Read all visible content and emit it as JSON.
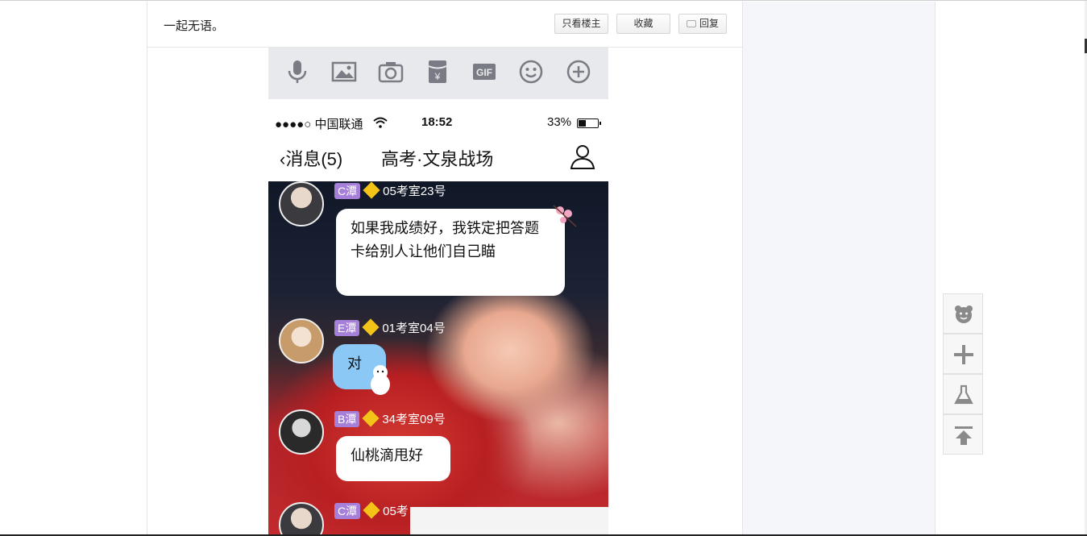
{
  "post": {
    "text": "一起无语。",
    "buttons": {
      "only_op": "只看楼主",
      "favorite": "收藏",
      "reply": "回复"
    }
  },
  "embedded_screenshot": {
    "toolbar_icons": [
      "microphone-icon",
      "image-icon",
      "camera-icon",
      "red-packet-icon",
      "gif-icon",
      "emoji-icon",
      "plus-icon"
    ],
    "toolbar_gif_label": "GIF",
    "toolbar_yen_label": "¥",
    "status_bar": {
      "carrier": "●●●●○ 中国联通",
      "time": "18:52",
      "battery": "33%"
    },
    "nav": {
      "back": "消息(5)",
      "title": "高考·文泉战场"
    },
    "messages": [
      {
        "level": "C潭",
        "sender": "05考室23号",
        "text": "如果我成绩好，我铁定把答题卡给别人让他们自己瞄"
      },
      {
        "level": "E潭",
        "sender": "01考室04号",
        "text": "对"
      },
      {
        "level": "B潭",
        "sender": "34考室09号",
        "text": "仙桃滴甩好"
      },
      {
        "level": "C潭",
        "sender": "05考",
        "text": ""
      }
    ]
  },
  "floating_tools": [
    "bear-icon",
    "add-icon",
    "flask-icon",
    "back-to-top-icon"
  ],
  "colors": {
    "accent_purple": "#a57fd8",
    "badge_gold": "#f3c317",
    "bubble_blue": "#8bc8f5",
    "side_bg": "#f5f6f9"
  }
}
